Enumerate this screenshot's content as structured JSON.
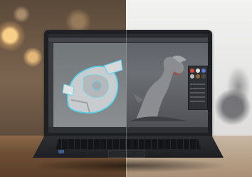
{
  "scene": {
    "description_colors": {
      "warm_background": "#7c6550",
      "cool_background": "#e4e4e3",
      "laptop_body": "#1f2023",
      "screen_accent": "#4fd4f0"
    },
    "icons": {
      "robot": "robot-3d-model-icon",
      "dragon": "dragon-render-icon"
    }
  }
}
